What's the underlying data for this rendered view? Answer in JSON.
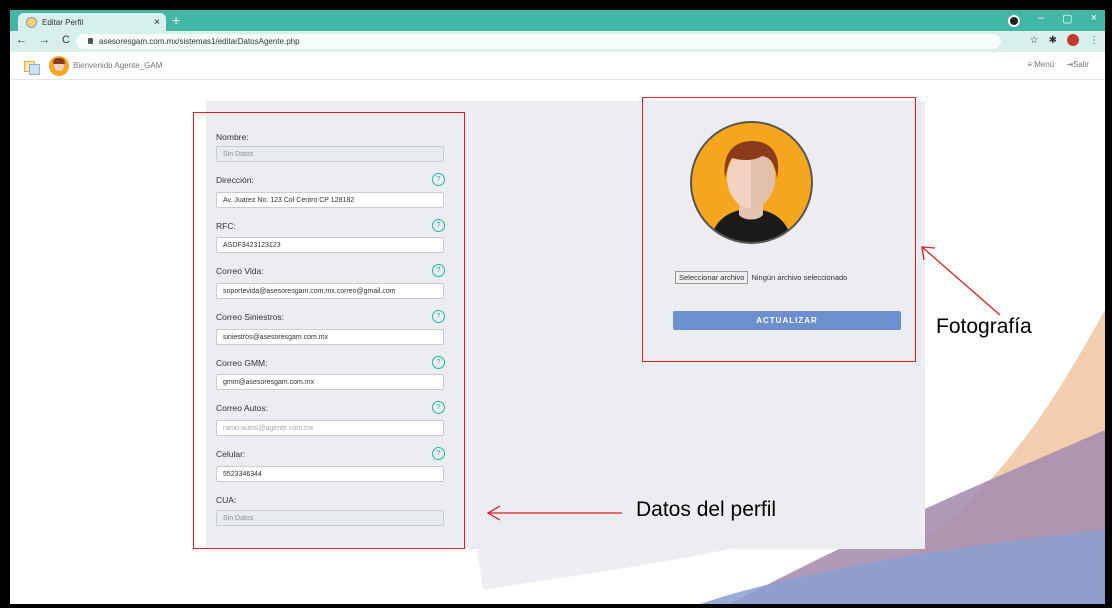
{
  "browser": {
    "tab_title": "Editar Perfil",
    "tab_close": "×",
    "new_tab": "+",
    "url": "asesoresgam.com.mx/sistemas1/editarDatosAgente.php",
    "win_min": "–",
    "win_max": "▢",
    "win_close": "×",
    "nav_back": "←",
    "nav_fwd": "→",
    "nav_reload": "C",
    "star": "☆",
    "puzzle": "✱",
    "menu_dots": "⋮"
  },
  "header": {
    "welcome": "Bienvenido Agente_GAM",
    "menu": "≡ Menú",
    "logout": "⇥Salir"
  },
  "form": {
    "nombre_label": "Nombre:",
    "nombre_value": "Sin Datos",
    "direccion_label": "Dirección:",
    "direccion_value": "Av. Juarez No. 123 Col Centro CP 128182",
    "rfc_label": "RFC:",
    "rfc_value": "ASDF3423123123",
    "correo_vida_label": "Correo Vida:",
    "correo_vida_value": "soportevida@asesoresgam.com.mx.correo@gmail.com",
    "correo_siniestros_label": "Correo Siniestros:",
    "correo_siniestros_value": "siniestros@asesoresgam.com.mx",
    "correo_gmm_label": "Correo GMM:",
    "correo_gmm_value": "gmm@asesoresgam.com.mx",
    "correo_autos_label": "Correo Autos:",
    "correo_autos_placeholder": "ramo-autos@agente.com.mx",
    "celular_label": "Celular:",
    "celular_value": "5523346344",
    "cua_label": "CUA:",
    "cua_value": "Sin Datos",
    "help_glyph": "?"
  },
  "photo": {
    "file_button": "Seleccionar archivo",
    "file_status": "Ningún archivo seleccionado",
    "update_button": "ACTUALIZAR"
  },
  "annotations": {
    "profile_label": "Datos del perfil",
    "photo_label": "Fotografía"
  },
  "colors": {
    "tab_strip": "#43b7a6",
    "annotation_red": "#e02020",
    "update_button": "#6b8fcf",
    "avatar_bg": "#f6a61e"
  }
}
